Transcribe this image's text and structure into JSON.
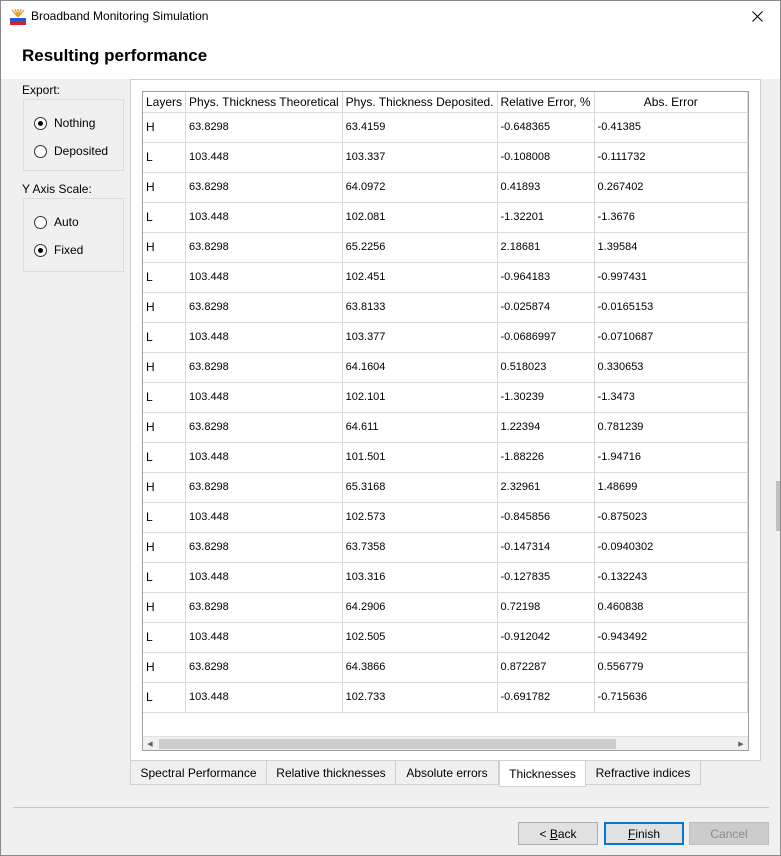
{
  "window": {
    "title": "Broadband Monitoring Simulation",
    "close_icon": "close-icon"
  },
  "header": {
    "title": "Resulting performance"
  },
  "export": {
    "label": "Export:",
    "options": [
      {
        "label": "Nothing",
        "checked": true
      },
      {
        "label": "Deposited",
        "checked": false
      }
    ]
  },
  "y_axis": {
    "label": "Y Axis Scale:",
    "options": [
      {
        "label": "Auto",
        "checked": false
      },
      {
        "label": "Fixed",
        "checked": true
      }
    ]
  },
  "table": {
    "columns": [
      "Layers",
      "Phys. Thickness Theoretical",
      "Phys. Thickness Deposited.",
      "Relative Error, %",
      "Abs. Error"
    ],
    "rows": [
      [
        "H",
        "63.8298",
        "63.4159",
        "-0.648365",
        "-0.41385"
      ],
      [
        "L",
        "103.448",
        "103.337",
        "-0.108008",
        "-0.111732"
      ],
      [
        "H",
        "63.8298",
        "64.0972",
        "0.41893",
        "0.267402"
      ],
      [
        "L",
        "103.448",
        "102.081",
        "-1.32201",
        "-1.3676"
      ],
      [
        "H",
        "63.8298",
        "65.2256",
        "2.18681",
        "1.39584"
      ],
      [
        "L",
        "103.448",
        "102.451",
        "-0.964183",
        "-0.997431"
      ],
      [
        "H",
        "63.8298",
        "63.8133",
        "-0.025874",
        "-0.0165153"
      ],
      [
        "L",
        "103.448",
        "103.377",
        "-0.0686997",
        "-0.0710687"
      ],
      [
        "H",
        "63.8298",
        "64.1604",
        "0.518023",
        "0.330653"
      ],
      [
        "L",
        "103.448",
        "102.101",
        "-1.30239",
        "-1.3473"
      ],
      [
        "H",
        "63.8298",
        "64.611",
        "1.22394",
        "0.781239"
      ],
      [
        "L",
        "103.448",
        "101.501",
        "-1.88226",
        "-1.94716"
      ],
      [
        "H",
        "63.8298",
        "65.3168",
        "2.32961",
        "1.48699"
      ],
      [
        "L",
        "103.448",
        "102.573",
        "-0.845856",
        "-0.875023"
      ],
      [
        "H",
        "63.8298",
        "63.7358",
        "-0.147314",
        "-0.0940302"
      ],
      [
        "L",
        "103.448",
        "103.316",
        "-0.127835",
        "-0.132243"
      ],
      [
        "H",
        "63.8298",
        "64.2906",
        "0.72198",
        "0.460838"
      ],
      [
        "L",
        "103.448",
        "102.505",
        "-0.912042",
        "-0.943492"
      ],
      [
        "H",
        "63.8298",
        "64.3866",
        "0.872287",
        "0.556779"
      ],
      [
        "L",
        "103.448",
        "102.733",
        "-0.691782",
        "-0.715636"
      ]
    ]
  },
  "tabs": [
    {
      "label": "Spectral Performance",
      "active": false
    },
    {
      "label": "Relative thicknesses",
      "active": false
    },
    {
      "label": "Absolute errors",
      "active": false
    },
    {
      "label": "Thicknesses",
      "active": true
    },
    {
      "label": "Refractive indices",
      "active": false
    }
  ],
  "buttons": {
    "back": {
      "mnemonic": "B",
      "rest": "ack",
      "prefix": "< "
    },
    "finish": {
      "mnemonic": "F",
      "rest": "inish"
    },
    "cancel": {
      "label": "Cancel"
    }
  },
  "colors": {
    "accent": "#0078d7"
  }
}
